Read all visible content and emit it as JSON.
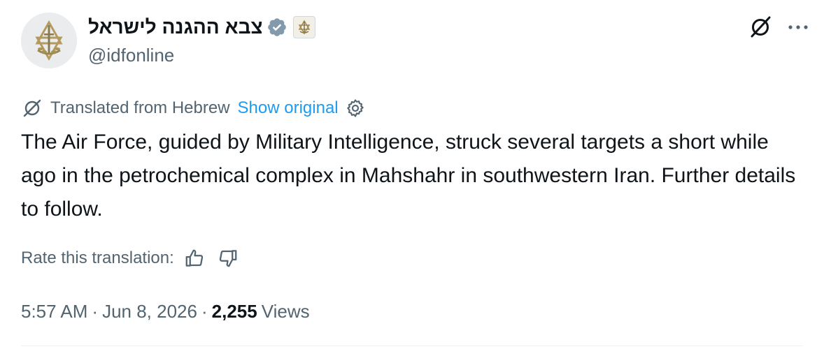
{
  "author": {
    "display_name": "צבא ההגנה לישראל",
    "handle": "@idfonline",
    "verified_icon": "verified-badge-icon",
    "affiliate_icon": "idf-emblem-icon"
  },
  "header_actions": {
    "grok_icon": "grok-icon",
    "more_icon": "more-horizontal-icon"
  },
  "translation": {
    "label": "Translated from Hebrew",
    "show_original": "Show original"
  },
  "tweet": {
    "text": "The Air Force, guided by Military Intelligence, struck several targets a short while ago in the petrochemical complex in Mahshahr in southwestern Iran. Further details to follow."
  },
  "rating": {
    "label": "Rate this translation:"
  },
  "meta": {
    "time": "5:57 AM",
    "date": "Jun 8, 2026",
    "separator": "·",
    "views_count": "2,255",
    "views_label": "Views"
  },
  "colors": {
    "text_primary": "#0f1419",
    "text_secondary": "#536471",
    "link": "#1d9bf0",
    "verified_badge": "#829aab",
    "divider": "#eff3f4"
  }
}
